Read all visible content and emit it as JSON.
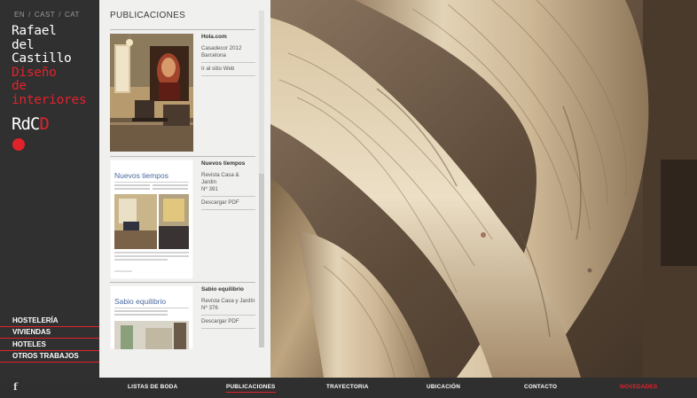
{
  "languages": [
    "EN",
    "/",
    "CAST",
    "/",
    "CAT"
  ],
  "logo": {
    "line1": "Rafael",
    "line2": "del",
    "line3": "Castillo",
    "line4": "Diseño",
    "line5": "de",
    "line6": "interiores",
    "mark_dark": "RdC",
    "mark_red": "D"
  },
  "sidebar_nav": [
    "HOSTELERÍA",
    "VIVIENDAS",
    "HOTELES",
    "OTROS TRABAJOS"
  ],
  "social": {
    "facebook": "f"
  },
  "panel": {
    "title": "PUBLICACIONES",
    "items": [
      {
        "title": "Hola.com",
        "detail1": "Casadecor 2012",
        "detail2": "Barcelona",
        "link": "Ir al sitio Web"
      },
      {
        "title": "Nuevos tiempos",
        "detail1": "Revista Casa & Jardín",
        "detail2": "Nº 391",
        "link": "Descargar PDF",
        "thumb_heading": "Nuevos tiempos"
      },
      {
        "title": "Sabio equilibrio",
        "detail1": "Revista Casa y Jardín",
        "detail2": "Nº 376",
        "link": "Descargar PDF",
        "thumb_heading": "Sabio equilibrio"
      }
    ]
  },
  "bottom_nav": [
    "LISTAS DE BODA",
    "PUBLICACIONES",
    "TRAYECTORIA",
    "UBICACIÓN",
    "CONTACTO",
    "NOVEDADES"
  ],
  "colors": {
    "accent": "#e2222b",
    "sidebar": "#303030",
    "panel": "#f0f0ef"
  }
}
